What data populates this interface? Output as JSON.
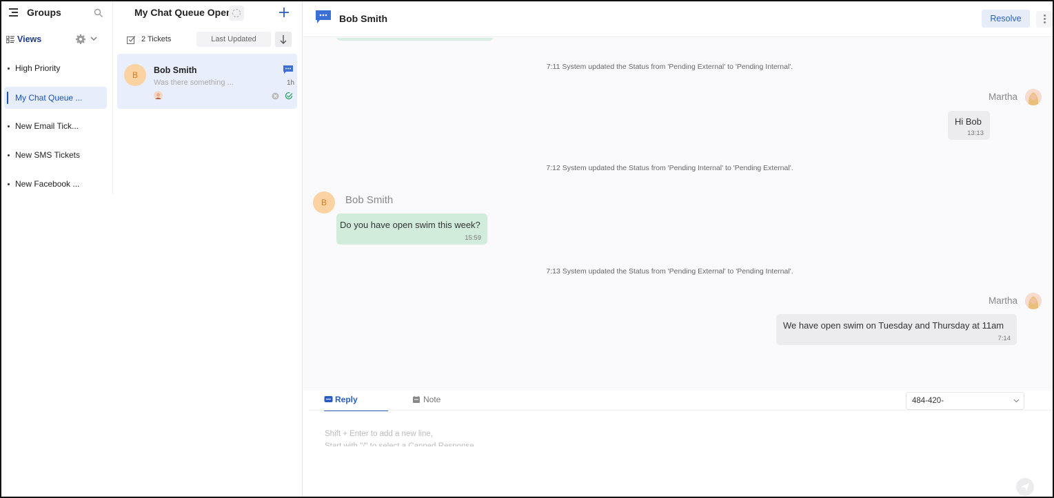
{
  "groups": {
    "title": "Groups",
    "views_label": "Views",
    "items": [
      {
        "label": "High Priority"
      },
      {
        "label": "My Chat Queue ..."
      },
      {
        "label": "New Email Tick..."
      },
      {
        "label": "New SMS Tickets"
      },
      {
        "label": "New Facebook ..."
      }
    ],
    "active_index": 1
  },
  "queue": {
    "title": "My Chat Queue Open",
    "tickets_count": "2 Tickets",
    "sort_label": "Last Updated",
    "tickets": [
      {
        "avatar_letter": "B",
        "name": "Bob Smith",
        "preview": "Was there something ...",
        "time": "1h"
      }
    ]
  },
  "conversation": {
    "title": "Bob Smith",
    "resolve_label": "Resolve",
    "system_messages": [
      "7:11 System updated the Status from 'Pending External' to 'Pending Internal'.",
      "7:12 System updated the Status from 'Pending Internal' to 'Pending External'.",
      "7:13 System updated the Status from 'Pending External' to 'Pending Internal'."
    ],
    "agent_name": "Martha",
    "customer_name": "Bob Smith",
    "customer_avatar_letter": "B",
    "messages": [
      {
        "from": "agent",
        "text": "Hi Bob",
        "time": "13:13"
      },
      {
        "from": "customer",
        "text": "Do you have open swim this week?",
        "time": "15:59"
      },
      {
        "from": "agent",
        "text": "We have open swim on Tuesday and Thursday at 11am",
        "time": "7:14"
      }
    ]
  },
  "composer": {
    "tab_reply": "Reply",
    "tab_note": "Note",
    "phone": "484-420-",
    "placeholder_line1": "Shift + Enter to add a new line,",
    "placeholder_line2": "Start with \"/\" to select a Canned Response"
  },
  "colors": {
    "accent": "#2b5fbf",
    "customer_bubble": "#d2ecdc",
    "agent_bubble": "#ececee",
    "active_item_bg": "#e6eefc"
  }
}
